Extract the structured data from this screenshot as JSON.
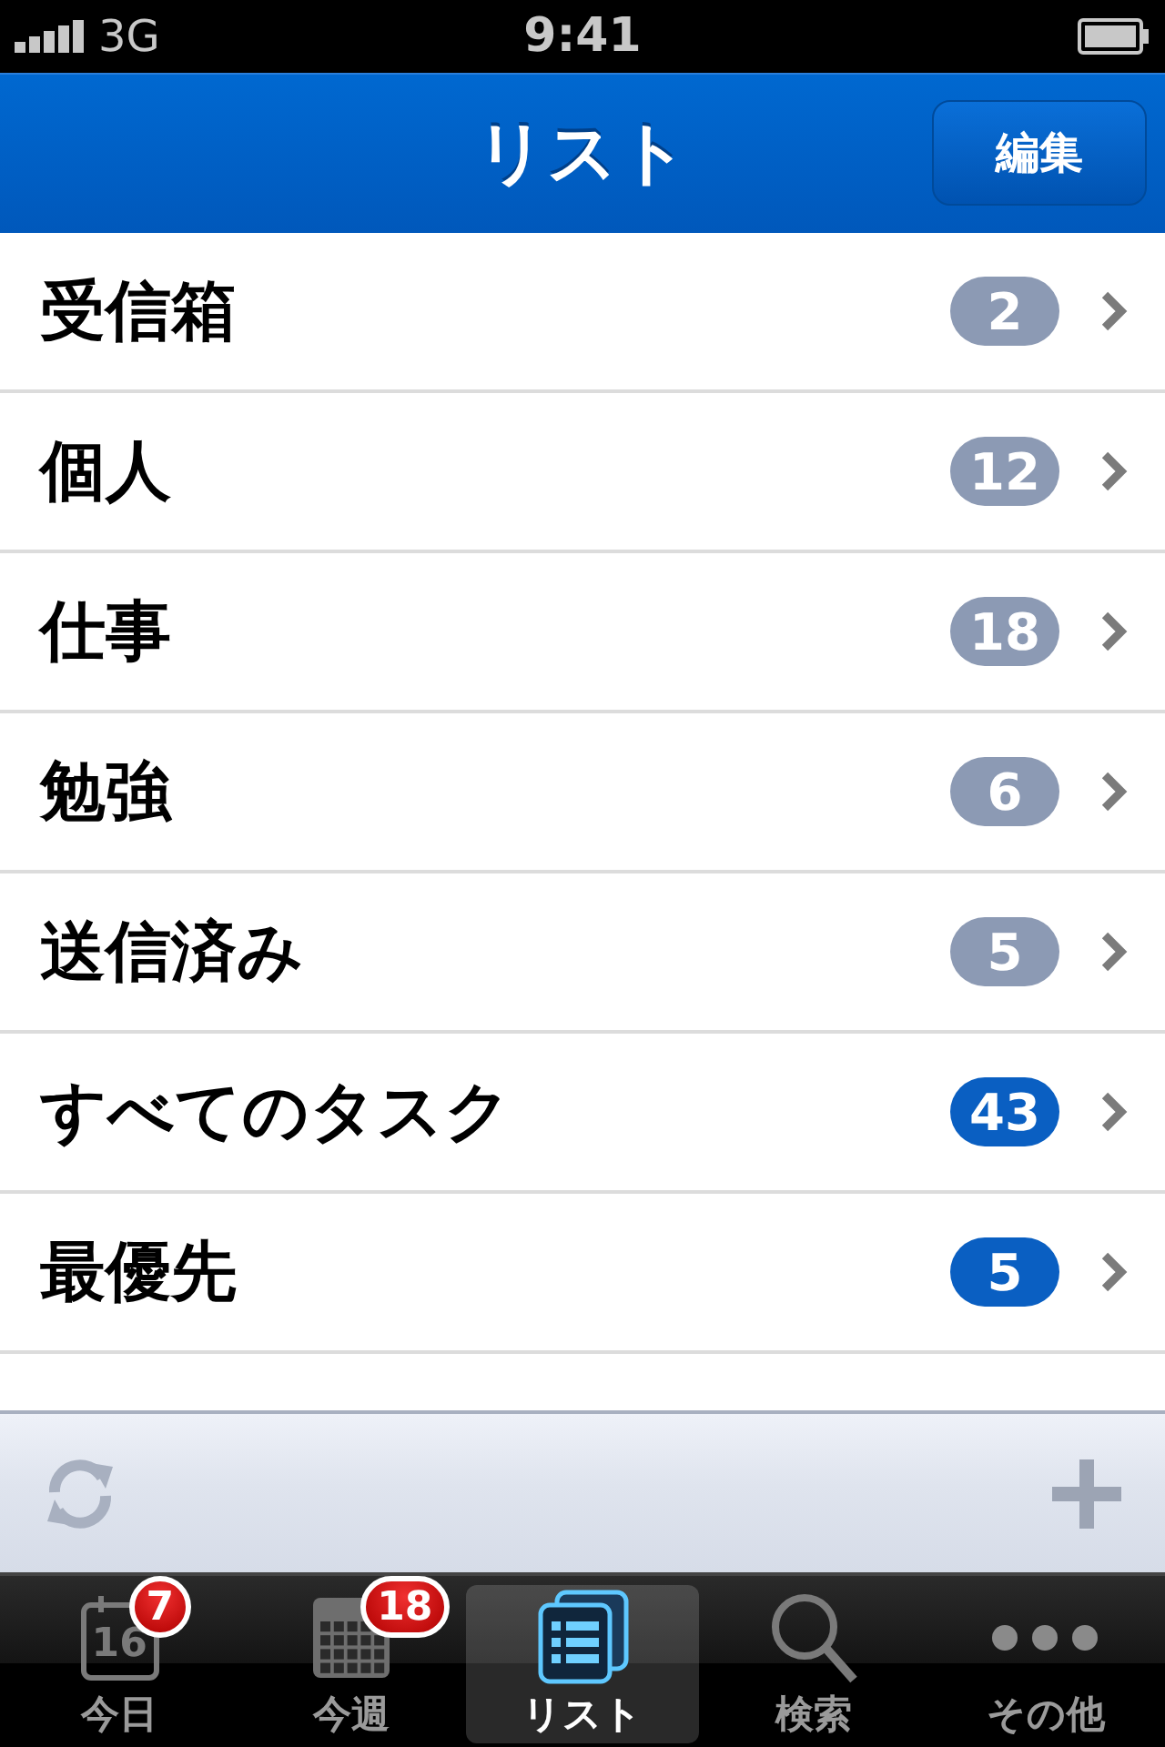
{
  "status_bar": {
    "carrier": "3G",
    "time": "9:41"
  },
  "nav_bar": {
    "title": "リスト",
    "edit_button": "編集"
  },
  "lists": [
    {
      "name": "受信箱",
      "count": "2",
      "color": "#8c9ab4"
    },
    {
      "name": "個人",
      "count": "12",
      "color": "#8c9ab4"
    },
    {
      "name": "仕事",
      "count": "18",
      "color": "#8c9ab4"
    },
    {
      "name": "勉強",
      "count": "6",
      "color": "#8c9ab4"
    },
    {
      "name": "送信済み",
      "count": "5",
      "color": "#8c9ab4"
    },
    {
      "name": "すべてのタスク",
      "count": "43",
      "color": "#0a5fc2"
    },
    {
      "name": "最優先",
      "count": "5",
      "color": "#0a5fc2"
    }
  ],
  "tab_bar": [
    {
      "kind": "today",
      "label": "今日",
      "icon_text": "16",
      "badge": "7",
      "selected": false
    },
    {
      "kind": "week",
      "label": "今週",
      "badge": "18",
      "selected": false
    },
    {
      "kind": "lists",
      "label": "リスト",
      "selected": true
    },
    {
      "kind": "search",
      "label": "検索",
      "selected": false
    },
    {
      "kind": "more",
      "label": "その他",
      "selected": false
    }
  ]
}
